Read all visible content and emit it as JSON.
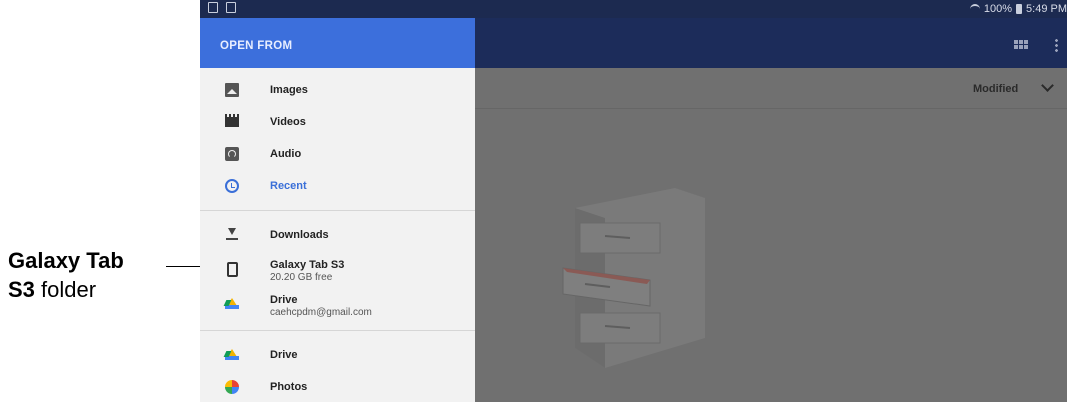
{
  "annotation": {
    "bold_line1": "Galaxy Tab",
    "bold_line2": "S3",
    "rest_line2": "folder"
  },
  "status_bar": {
    "battery": "100%",
    "time": "5:49 PM"
  },
  "drawer": {
    "title": "OPEN FROM",
    "items": [
      {
        "label": "Images",
        "icon": "image-icon"
      },
      {
        "label": "Videos",
        "icon": "video-icon"
      },
      {
        "label": "Audio",
        "icon": "audio-icon"
      },
      {
        "label": "Recent",
        "icon": "clock-icon",
        "active": true
      },
      {
        "label": "Downloads",
        "icon": "download-icon"
      },
      {
        "label": "Galaxy Tab S3",
        "sub": "20.20 GB free",
        "icon": "tablet-icon"
      },
      {
        "label": "Drive",
        "sub": "caehcpdm@gmail.com",
        "icon": "drive-icon"
      },
      {
        "label": "Drive",
        "icon": "drive-icon"
      },
      {
        "label": "Photos",
        "icon": "photos-icon"
      }
    ]
  },
  "content": {
    "sort_label": "Modified"
  },
  "colors": {
    "accent": "#3a6fd8",
    "header": "#3c6fdc",
    "appbar": "#1c2c5a"
  }
}
